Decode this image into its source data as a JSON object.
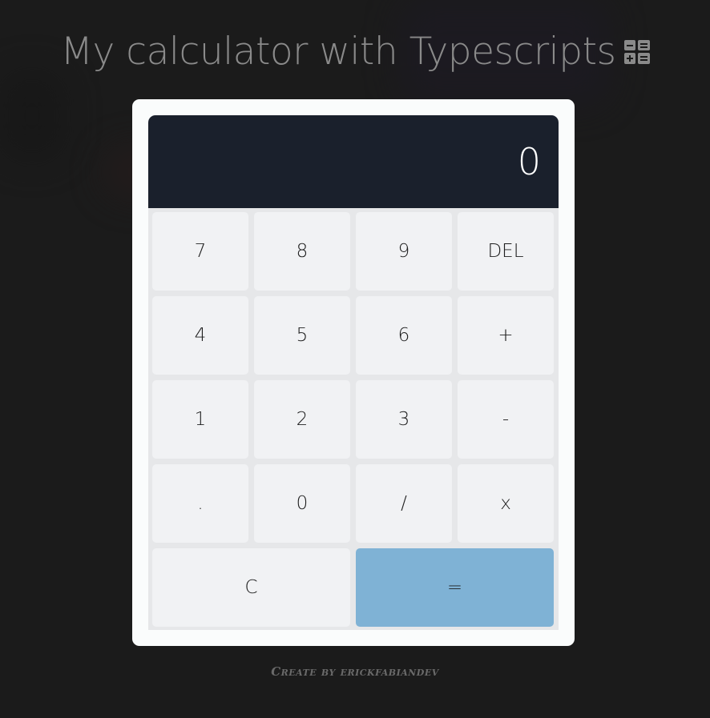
{
  "header": {
    "title": "My calculator with Typescripts",
    "icon": "calculator-icon"
  },
  "calculator": {
    "display_value": "0",
    "keys": [
      {
        "label": "7",
        "name": "key-7"
      },
      {
        "label": "8",
        "name": "key-8"
      },
      {
        "label": "9",
        "name": "key-9"
      },
      {
        "label": "DEL",
        "name": "key-delete"
      },
      {
        "label": "4",
        "name": "key-4"
      },
      {
        "label": "5",
        "name": "key-5"
      },
      {
        "label": "6",
        "name": "key-6"
      },
      {
        "label": "+",
        "name": "key-add"
      },
      {
        "label": "1",
        "name": "key-1"
      },
      {
        "label": "2",
        "name": "key-2"
      },
      {
        "label": "3",
        "name": "key-3"
      },
      {
        "label": "-",
        "name": "key-subtract"
      },
      {
        "label": ".",
        "name": "key-decimal"
      },
      {
        "label": "0",
        "name": "key-0"
      },
      {
        "label": "/",
        "name": "key-divide"
      },
      {
        "label": "x",
        "name": "key-multiply"
      },
      {
        "label": "C",
        "name": "key-clear"
      },
      {
        "label": "=",
        "name": "key-equals"
      }
    ]
  },
  "footer": {
    "credit": "Create by erickfabiandev"
  },
  "colors": {
    "background": "#1b1b1b",
    "card": "#fafcfc",
    "display": "#1a202c",
    "key": "#f1f2f4",
    "equals_key": "#7fb2d5"
  }
}
